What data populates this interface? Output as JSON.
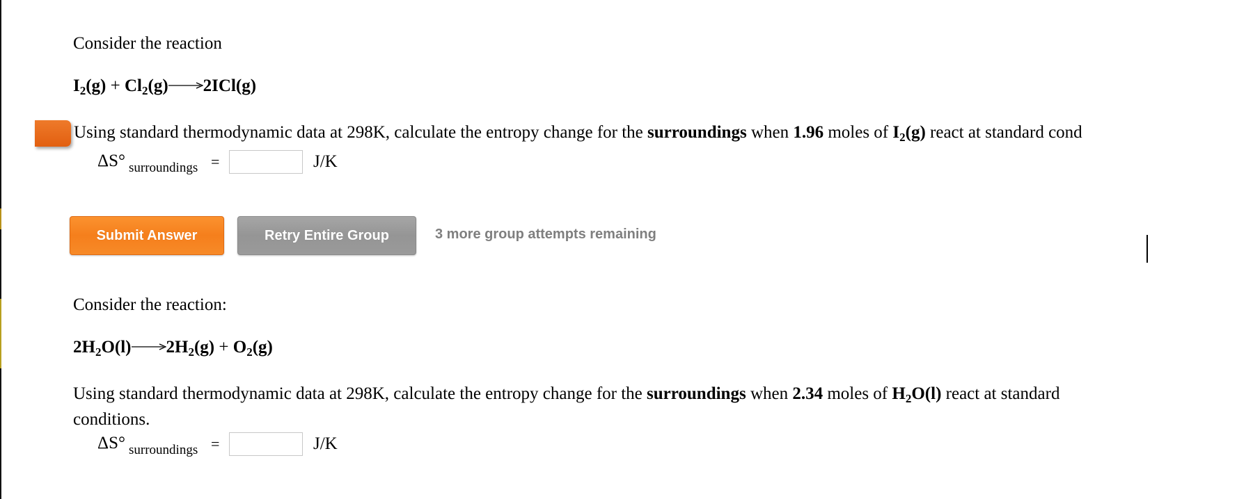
{
  "questions": [
    {
      "intro": "Consider the reaction",
      "equation": {
        "reactants": [
          {
            "symbol": "I",
            "sub": "2",
            "state": "(g)"
          },
          {
            "symbol": "Cl",
            "sub": "2",
            "state": "(g)"
          }
        ],
        "plus": "+",
        "products": [
          {
            "coef": "2",
            "symbol": "ICl",
            "state": "(g)"
          }
        ]
      },
      "prompt": {
        "before": "Using standard thermodynamic data at 298K, calculate the entropy change for the ",
        "bold_word": "surroundings",
        "mid": " when ",
        "moles": "1.96",
        "after_moles": " moles of ",
        "species_symbol": "I",
        "species_sub": "2",
        "species_state": "(g)",
        "end": " react at standard cond"
      },
      "answer_label": {
        "delta": "ΔS°",
        "subscript": "surroundings",
        "equals": "="
      },
      "answer_value": "",
      "unit": "J/K",
      "flagged": true,
      "flag_color": "#e8671a"
    },
    {
      "intro": "Consider the reaction:",
      "equation": {
        "reactants": [
          {
            "coef": "2",
            "symbol": "H",
            "sub": "2",
            "symbol2": "O",
            "state": "(l)"
          }
        ],
        "plus": "+",
        "products": [
          {
            "coef": "2",
            "symbol": "H",
            "sub": "2",
            "state": "(g)"
          },
          {
            "symbol": "O",
            "sub": "2",
            "state": "(g)"
          }
        ]
      },
      "prompt": {
        "before": "Using standard thermodynamic data at 298K, calculate the entropy change for the ",
        "bold_word": "surroundings",
        "mid": " when ",
        "moles": "2.34",
        "after_moles": " moles of ",
        "species_symbol": "H",
        "species_sub": "2",
        "species_symbol2": "O",
        "species_state": "(l)",
        "end": " react at standard",
        "line2": "conditions."
      },
      "answer_label": {
        "delta": "ΔS°",
        "subscript": "surroundings",
        "equals": "="
      },
      "answer_value": "",
      "unit": "J/K"
    }
  ],
  "actions": {
    "submit_label": "Submit Answer",
    "retry_label": "Retry Entire Group",
    "attempts_text": "3 more group attempts remaining",
    "submit_color": "#f7851f",
    "retry_color": "#9b9b9b"
  }
}
